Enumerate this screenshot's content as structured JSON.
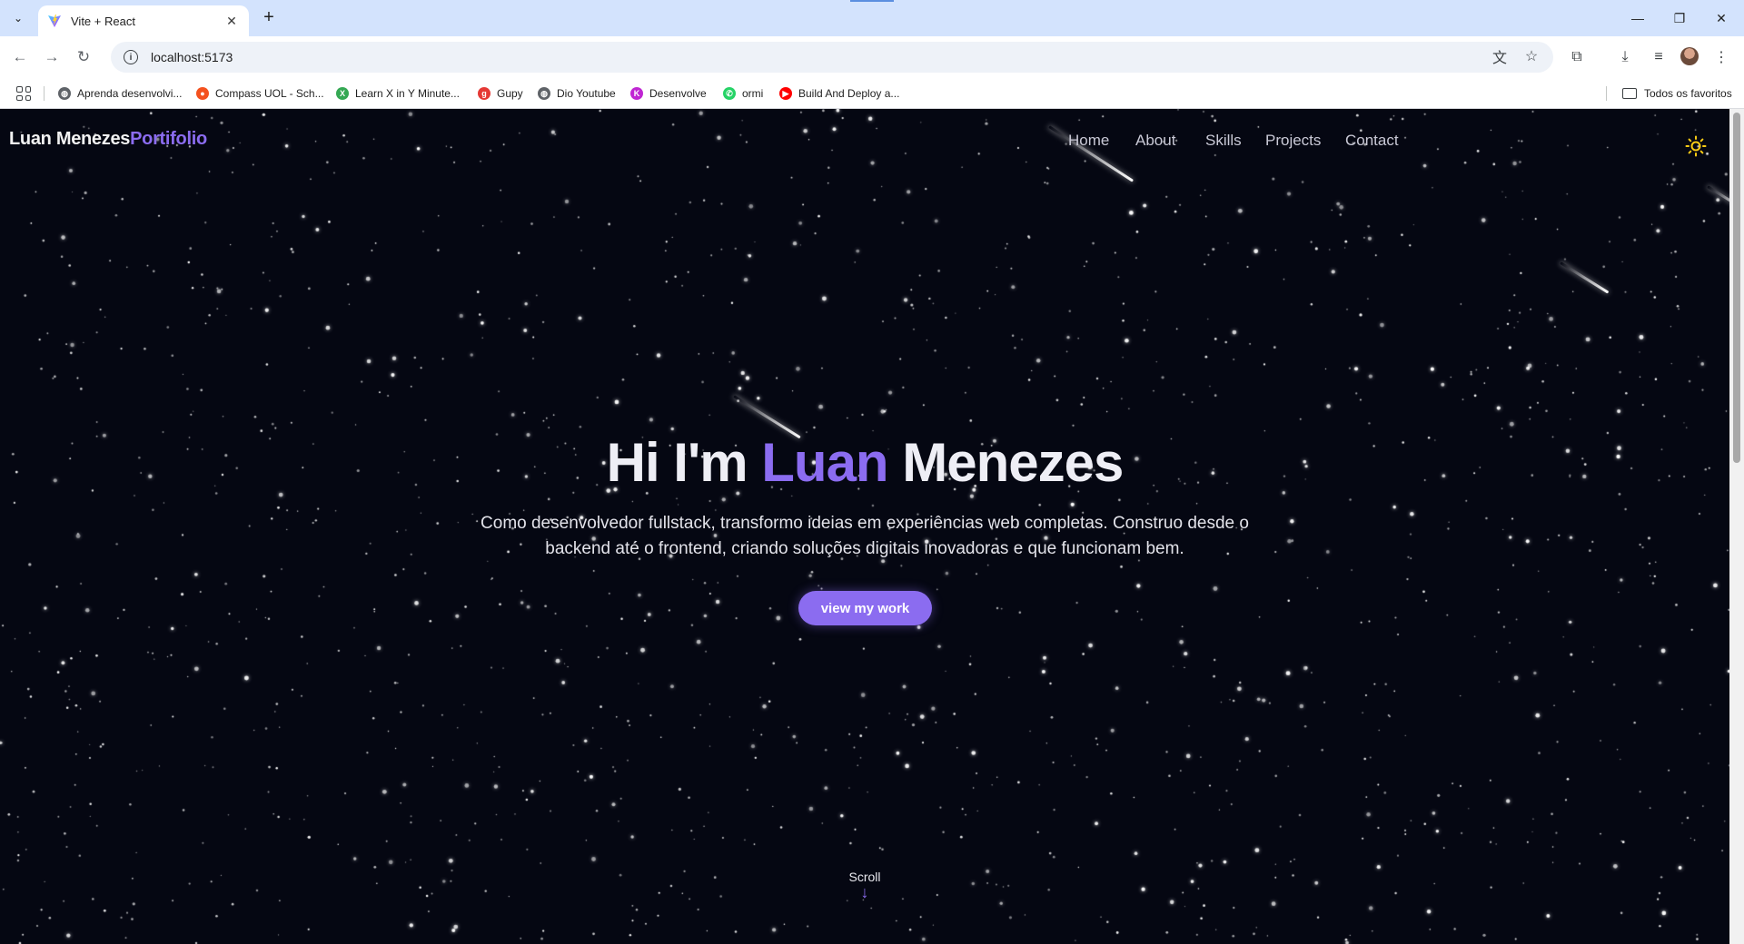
{
  "browser": {
    "tab_title": "Vite + React",
    "url": "localhost:5173",
    "bookmarks": [
      {
        "label": "Aprenda desenvolvi...",
        "icon": "globe-icon",
        "color": "#5f6368"
      },
      {
        "label": "Compass UOL - Sch...",
        "icon": "compass-icon",
        "color": "#f4511e"
      },
      {
        "label": "Learn X in Y Minute...",
        "icon": "learnx-icon",
        "color": "#34a853"
      },
      {
        "label": "Gupy",
        "icon": "gupy-icon",
        "color": "#e53935"
      },
      {
        "label": "Dio Youtube",
        "icon": "globe-icon",
        "color": "#5f6368"
      },
      {
        "label": "Desenvolve",
        "icon": "desenvolve-icon",
        "color": "#c026d3"
      },
      {
        "label": "ormi",
        "icon": "whatsapp-icon",
        "color": "#25d366"
      },
      {
        "label": "Build And Deploy a...",
        "icon": "youtube-icon",
        "color": "#ff0000"
      }
    ],
    "all_bookmarks_label": "Todos os favoritos"
  },
  "page": {
    "brand": {
      "name": "Luan Menezes",
      "accent": "Portifolio"
    },
    "nav": [
      "Home",
      "About",
      "Skills",
      "Projects",
      "Contact"
    ],
    "hero": {
      "greeting": "Hi I'm",
      "first_name": "Luan",
      "last_name": "Menezes",
      "subtitle": "Como desenvolvedor fullstack, transformo ideias em experiências web completas. Construo desde o backend até o frontend, criando soluções digitais inovadoras e que funcionam bem.",
      "cta_label": "view my work"
    },
    "scroll_label": "Scroll",
    "colors": {
      "background": "#050712",
      "accent": "#8b6cf0",
      "text": "#eeeef5"
    },
    "theme_toggle_icon": "sun-icon"
  }
}
